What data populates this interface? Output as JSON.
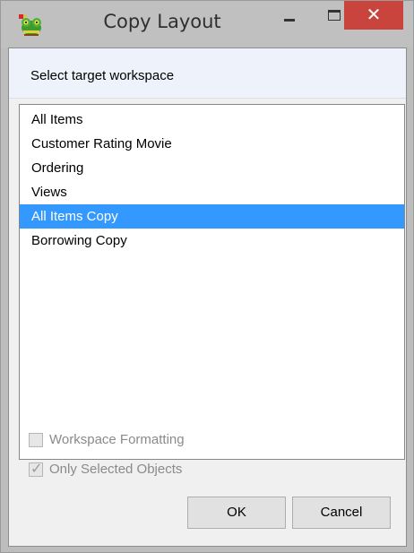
{
  "window": {
    "title": "Copy Layout",
    "app_icon": "frog-app-icon",
    "close_glyph": "✕"
  },
  "header": {
    "text": "Select target workspace"
  },
  "list": {
    "items": [
      {
        "label": "All Items",
        "selected": false
      },
      {
        "label": "Customer Rating Movie",
        "selected": false
      },
      {
        "label": "Ordering",
        "selected": false
      },
      {
        "label": "Views",
        "selected": false
      },
      {
        "label": "All Items Copy",
        "selected": true
      },
      {
        "label": "Borrowing Copy",
        "selected": false
      }
    ]
  },
  "options": {
    "workspace_formatting": {
      "label": "Workspace Formatting",
      "checked": false,
      "enabled": false
    },
    "only_selected_objects": {
      "label": "Only Selected Objects",
      "checked": true,
      "enabled": false
    }
  },
  "buttons": {
    "ok": "OK",
    "cancel": "Cancel"
  },
  "colors": {
    "selection": "#3399ff",
    "close_button": "#c9443c"
  }
}
